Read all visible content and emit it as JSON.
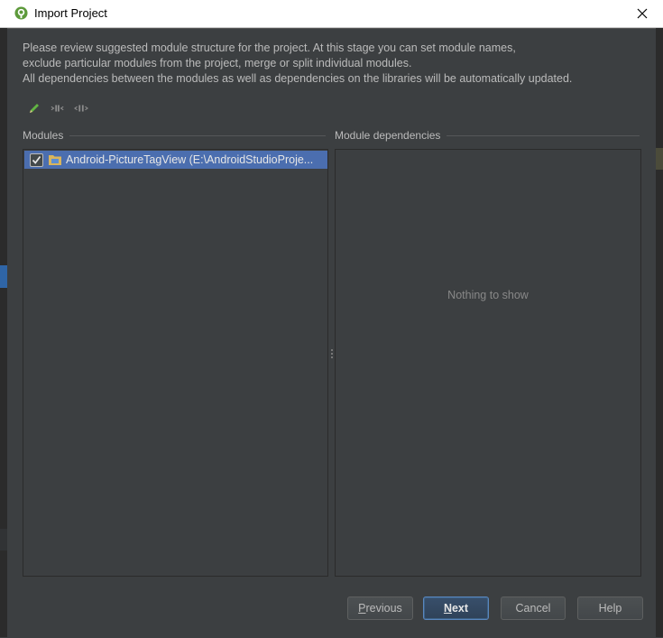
{
  "window": {
    "title": "Import Project",
    "close_icon": "close-icon",
    "app_icon": "android-studio-icon"
  },
  "description": {
    "line1": "Please review suggested module structure for the project. At this stage you can set module names,",
    "line2": "exclude particular modules from the project, merge or split individual modules.",
    "line3": "All dependencies between the modules as well as dependencies on the libraries will be automatically updated."
  },
  "toolbar": {
    "icons": [
      "rename-pencil-icon",
      "merge-modules-icon",
      "split-module-icon"
    ]
  },
  "modules": {
    "label": "Modules",
    "items": [
      {
        "checked": true,
        "text": "Android-PictureTagView (E:\\AndroidStudioProje..."
      }
    ]
  },
  "dependencies": {
    "label": "Module dependencies",
    "empty_text": "Nothing to show"
  },
  "buttons": {
    "previous": {
      "mnemonic": "P",
      "rest": "revious"
    },
    "next": {
      "mnemonic": "N",
      "rest": "ext"
    },
    "cancel": "Cancel",
    "help": "Help"
  },
  "colors": {
    "background": "#3c3f41",
    "selection": "#4b6eaf",
    "text": "#bbbbbb",
    "default_button_border": "#5a87bf"
  }
}
